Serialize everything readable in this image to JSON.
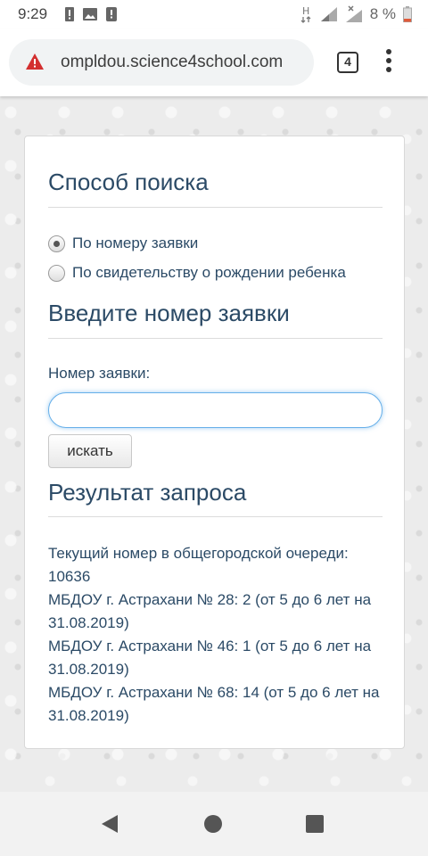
{
  "status_bar": {
    "time": "9:29",
    "network_letter": "H",
    "battery_pct": "8 %"
  },
  "browser": {
    "url": "ompldou.science4school.com",
    "tab_count": "4"
  },
  "form": {
    "search_method_title": "Способ поиска",
    "radio_options": [
      {
        "label": "По номеру заявки",
        "checked": true
      },
      {
        "label": "По свидетельству о рождении ребенка",
        "checked": false
      }
    ],
    "enter_number_title": "Введите номер заявки",
    "number_label": "Номер заявки:",
    "number_value": "",
    "search_button": "искать"
  },
  "result": {
    "title": "Результат запроса",
    "lines": [
      "Текущий номер в общегородской очереди: 10636",
      "МБДОУ г. Астрахани № 28: 2 (от 5 до 6 лет на 31.08.2019)",
      "МБДОУ г. Астрахани № 46: 1 (от 5 до 6 лет на 31.08.2019)",
      "МБДОУ г. Астрахани № 68: 14 (от 5 до 6 лет на 31.08.2019)"
    ]
  },
  "colors": {
    "heading_text": "#2b4a66",
    "input_focus": "#66afe9",
    "warning": "#d32f2f"
  }
}
